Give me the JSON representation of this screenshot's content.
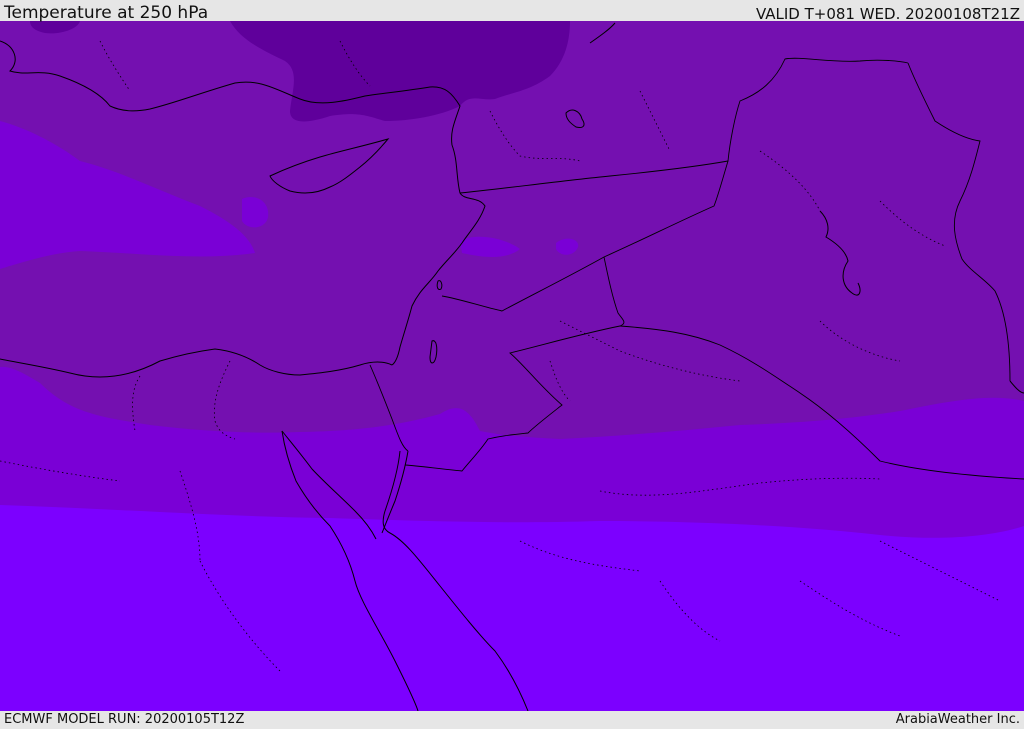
{
  "header": {
    "title": "Temperature at 250 hPa",
    "valid": "VALID T+081 WED. 20200108T21Z"
  },
  "footer": {
    "model_run": "ECMWF MODEL RUN: 20200105T12Z",
    "credit": "ArabiaWeather Inc."
  },
  "colors": {
    "band_coldest": "#5f009b",
    "band_cold": "#7410b0",
    "band_mid": "#7a00d6",
    "band_warm": "#7c00ff",
    "coastline": "#000000",
    "background": "#e6e6e6"
  }
}
